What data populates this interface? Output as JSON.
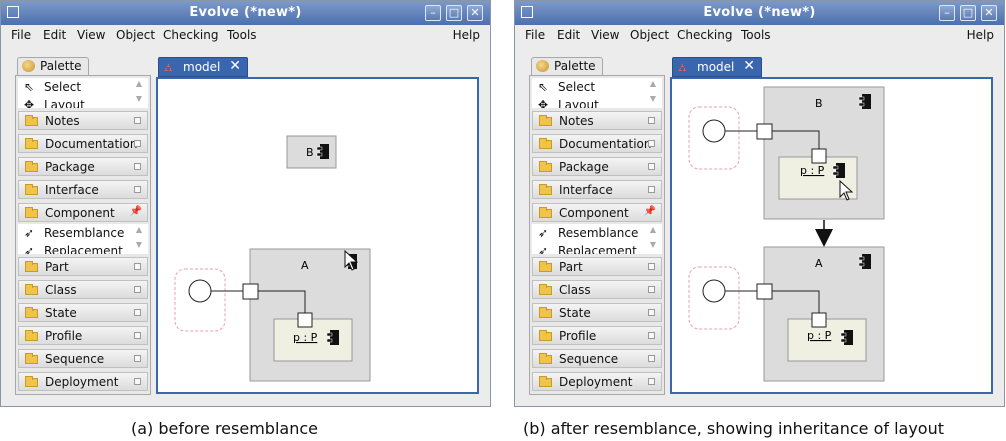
{
  "window_a": {
    "title": "Evolve (*new*)",
    "menu": [
      "File",
      "Edit",
      "View",
      "Object",
      "Checking",
      "Tools"
    ],
    "help": "Help",
    "palette_tab": "Palette",
    "tools_top": [
      "Select",
      "Layout"
    ],
    "categories_top": [
      "Notes",
      "Documentation",
      "Package",
      "Interface",
      "Component"
    ],
    "tools_component": [
      "Resemblance",
      "Replacement"
    ],
    "categories_bottom": [
      "Part",
      "Class",
      "State",
      "Profile",
      "Sequence",
      "Deployment"
    ],
    "model_tab": "model",
    "diagram": {
      "component_b": "B",
      "component_a": "A",
      "part": "p : P"
    }
  },
  "window_b": {
    "title": "Evolve (*new*)",
    "menu": [
      "File",
      "Edit",
      "View",
      "Object",
      "Checking",
      "Tools"
    ],
    "help": "Help",
    "palette_tab": "Palette",
    "tools_top": [
      "Select",
      "Layout"
    ],
    "categories_top": [
      "Notes",
      "Documentation",
      "Package",
      "Interface",
      "Component"
    ],
    "tools_component": [
      "Resemblance",
      "Replacement"
    ],
    "categories_bottom": [
      "Part",
      "Class",
      "State",
      "Profile",
      "Sequence",
      "Deployment"
    ],
    "model_tab": "model",
    "diagram": {
      "component_b": "B",
      "component_a": "A",
      "part_b": "p : P",
      "part_a": "p : P"
    }
  },
  "captions": {
    "a": "(a) before resemblance",
    "b": "(b) after resemblance, showing inheritance of layout"
  },
  "icons": {
    "select": "arrow-pointer-icon",
    "layout": "layout-move-icon",
    "resemblance": "resemblance-arrow-icon",
    "replacement": "replacement-arrow-icon",
    "palette": "palette-icon",
    "model": "model-tree-icon"
  },
  "colors": {
    "title_bar": "#5b7fbd",
    "canvas_border": "#3a66b0",
    "component_fill": "#dcdcdc",
    "part_fill": "#efefe2",
    "port_region": "#e9a0a8"
  }
}
